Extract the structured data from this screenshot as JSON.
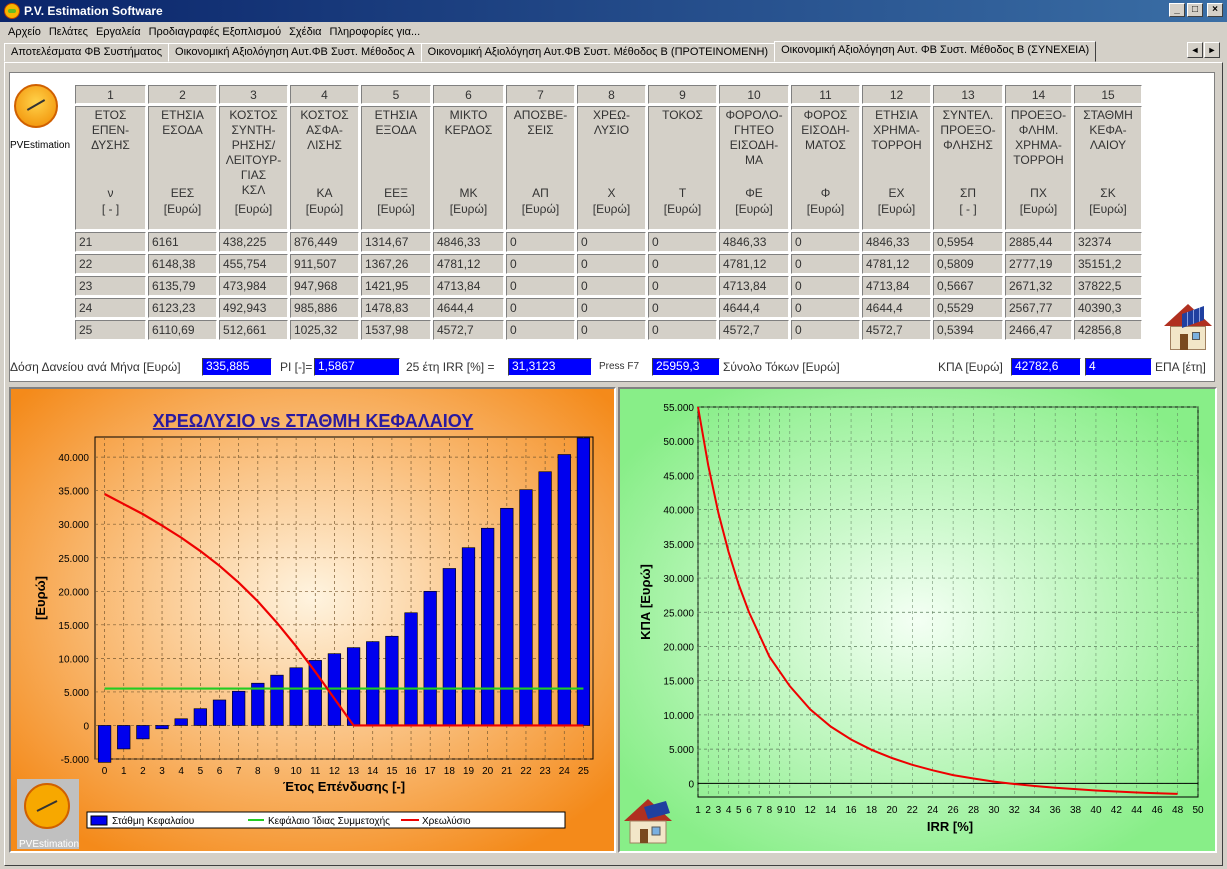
{
  "window": {
    "title": "P.V. Estimation Software"
  },
  "menu": [
    "Αρχείο",
    "Πελάτες",
    "Εργαλεία",
    "Προδιαγραφές Εξοπλισμού",
    "Σχέδια",
    "Πληροφορίες για..."
  ],
  "tabs": [
    "Αποτελέσματα ΦΒ Συστήματος",
    "Οικονομική Αξιολόγηση Αυτ.ΦΒ Συστ. Μέθοδος Α",
    "Οικονομική Αξιολόγηση Αυτ.ΦΒ Συστ. Μέθοδος Β (ΠΡΟΤΕΙΝΟΜΕΝΗ)",
    "Οικονομική Αξιολόγηση Αυτ. ΦΒ Συστ. Μέθοδος Β (ΣΥΝΕΧΕΙΑ)"
  ],
  "logo_caption": "PVEstimation",
  "table": {
    "col_numbers": [
      "1",
      "2",
      "3",
      "4",
      "5",
      "6",
      "7",
      "8",
      "9",
      "10",
      "11",
      "12",
      "13",
      "14",
      "15"
    ],
    "headers": [
      {
        "name": "ΕΤΟΣ\nΕΠΕΝ-\nΔΥΣΗΣ",
        "sym": "ν\n[ - ]"
      },
      {
        "name": "ΕΤΗΣΙΑ\nΕΣΟΔΑ",
        "sym": "ΕΕΣ\n[Ευρώ]"
      },
      {
        "name": "ΚΟΣΤΟΣ\nΣΥΝΤΗ-\nΡΗΣΗΣ/\nΛΕΙΤΟΥΡ-\nΓΙΑΣ\nΚΣΛ",
        "sym": "[Ευρώ]"
      },
      {
        "name": "ΚΟΣΤΟΣ\nΑΣΦΑ-\nΛΙΣΗΣ",
        "sym": "ΚΑ\n[Ευρώ]"
      },
      {
        "name": "ΕΤΗΣΙΑ\nΕΞΟΔΑ",
        "sym": "ΕΕΞ\n[Ευρώ]"
      },
      {
        "name": "ΜΙΚΤΟ\nΚΕΡΔΟΣ",
        "sym": "ΜΚ\n[Ευρώ]"
      },
      {
        "name": "ΑΠΟΣΒΕ-\nΣΕΙΣ",
        "sym": "ΑΠ\n[Ευρώ]"
      },
      {
        "name": "ΧΡΕΩ-\nΛΥΣΙΟ",
        "sym": "Χ\n[Ευρώ]"
      },
      {
        "name": "ΤΟΚΟΣ",
        "sym": "Τ\n[Ευρώ]"
      },
      {
        "name": "ΦΟΡΟΛΟ-\nΓΗΤΕΟ\nΕΙΣΟΔΗ-\nΜΑ",
        "sym": "ΦΕ\n[Ευρώ]"
      },
      {
        "name": "ΦΟΡΟΣ\nΕΙΣΟΔΗ-\nΜΑΤΟΣ",
        "sym": "Φ\n[Ευρώ]"
      },
      {
        "name": "ΕΤΗΣΙΑ\nΧΡΗΜΑ-\nΤΟΡΡΟΗ",
        "sym": "ΕΧ\n[Ευρώ]"
      },
      {
        "name": "ΣΥΝΤΕΛ.\nΠΡΟΕΞΟ-\nΦΛΗΣΗΣ",
        "sym": "ΣΠ\n[ - ]"
      },
      {
        "name": "ΠΡΟΕΞΟ-\nΦΛΗΜ.\nΧΡΗΜΑ-\nΤΟΡΡΟΗ",
        "sym": "ΠΧ\n[Ευρώ]"
      },
      {
        "name": "ΣΤΑΘΜΗ\nΚΕΦΑ-\nΛΑΙΟΥ",
        "sym": "ΣΚ\n[Ευρώ]"
      }
    ],
    "rows": [
      [
        "21",
        "6161",
        "438,225",
        "876,449",
        "1314,67",
        "4846,33",
        "0",
        "0",
        "0",
        "4846,33",
        "0",
        "4846,33",
        "0,5954",
        "2885,44",
        "32374"
      ],
      [
        "22",
        "6148,38",
        "455,754",
        "911,507",
        "1367,26",
        "4781,12",
        "0",
        "0",
        "0",
        "4781,12",
        "0",
        "4781,12",
        "0,5809",
        "2777,19",
        "35151,2"
      ],
      [
        "23",
        "6135,79",
        "473,984",
        "947,968",
        "1421,95",
        "4713,84",
        "0",
        "0",
        "0",
        "4713,84",
        "0",
        "4713,84",
        "0,5667",
        "2671,32",
        "37822,5"
      ],
      [
        "24",
        "6123,23",
        "492,943",
        "985,886",
        "1478,83",
        "4644,4",
        "0",
        "0",
        "0",
        "4644,4",
        "0",
        "4644,4",
        "0,5529",
        "2567,77",
        "40390,3"
      ],
      [
        "25",
        "6110,69",
        "512,661",
        "1025,32",
        "1537,98",
        "4572,7",
        "0",
        "0",
        "0",
        "4572,7",
        "0",
        "4572,7",
        "0,5394",
        "2466,47",
        "42856,8"
      ]
    ]
  },
  "summary": {
    "loan_label": "Δόση Δανείου ανά Μήνα [Ευρώ]",
    "loan_value": "335,885",
    "pi_label": "PI [-]=",
    "pi_value": "1,5867",
    "irr_label": "25 έτη IRR [%] =",
    "irr_value": "31,3123",
    "press_label": "Press F7",
    "interest_value": "25959,3",
    "interest_label": "Σύνολο Τόκων [Ευρώ]",
    "npv_label": "ΚΠΑ [Ευρώ]",
    "npv_value": "42782,6",
    "payback_value": "4",
    "payback_label": "ΕΠΑ [έτη]"
  },
  "colors": {
    "bar": "#0000ee",
    "equity_line": "#22cc22",
    "amortization_line": "#ee0000",
    "left_bg": "#f48a1a",
    "right_bg": "#88ee88"
  },
  "chart_data": [
    {
      "type": "bar",
      "title": "ΧΡΕΩΛΥΣΙΟ vs ΣΤΑΘΜΗ ΚΕΦΑΛΑΙΟΥ",
      "xlabel": "Έτος Επένδυσης [-]",
      "ylabel": "[Ευρώ]",
      "ylim": [
        -5000,
        43000
      ],
      "yticks": [
        "-5.000",
        "0",
        "5.000",
        "10.000",
        "15.000",
        "20.000",
        "25.000",
        "30.000",
        "35.000",
        "40.000"
      ],
      "grid": true,
      "legend_position": "bottom",
      "categories": [
        0,
        1,
        2,
        3,
        4,
        5,
        6,
        7,
        8,
        9,
        10,
        11,
        12,
        13,
        14,
        15,
        16,
        17,
        18,
        19,
        20,
        21,
        22,
        23,
        24,
        25
      ],
      "series": [
        {
          "name": "Στάθμη Κεφαλαίου",
          "type": "bar",
          "values": [
            -5500,
            -3500,
            -2000,
            -500,
            1000,
            2500,
            3800,
            5100,
            6300,
            7500,
            8600,
            9700,
            10700,
            11600,
            12500,
            13300,
            16800,
            20000,
            23400,
            26500,
            29400,
            32374,
            35151,
            37822,
            40390,
            42857
          ]
        },
        {
          "name": "Κεφάλαιο Ίδιας Συμμετοχής",
          "type": "line",
          "values": [
            5500,
            5500,
            5500,
            5500,
            5500,
            5500,
            5500,
            5500,
            5500,
            5500,
            5500,
            5500,
            5500,
            5500,
            5500,
            5500,
            5500,
            5500,
            5500,
            5500,
            5500,
            5500,
            5500,
            5500,
            5500,
            5500
          ]
        },
        {
          "name": "Χρεωλύσιο",
          "type": "line",
          "values": [
            34500,
            33000,
            31500,
            29800,
            28000,
            26000,
            23800,
            21300,
            18500,
            15300,
            11800,
            8000,
            4000,
            0,
            0,
            0,
            0,
            0,
            0,
            0,
            0,
            0,
            0,
            0,
            0,
            0
          ],
          "x": [
            0,
            1,
            2,
            3,
            4,
            5,
            6,
            7,
            8,
            9,
            10,
            11,
            12,
            13,
            14,
            15,
            16,
            17,
            18,
            19,
            20,
            21,
            22,
            23,
            24,
            25
          ]
        }
      ]
    },
    {
      "type": "line",
      "xlabel": "IRR [%]",
      "ylabel": "ΚΠΑ [Ευρώ]",
      "ylim": [
        -2000,
        55000
      ],
      "xlim": [
        1,
        50
      ],
      "yticks": [
        "0",
        "5.000",
        "10.000",
        "15.000",
        "20.000",
        "25.000",
        "30.000",
        "35.000",
        "40.000",
        "45.000",
        "50.000",
        "55.000"
      ],
      "xticks": [
        "1",
        "2",
        "3",
        "4",
        "5",
        "6",
        "7",
        "8",
        "9",
        "10",
        "12",
        "14",
        "16",
        "18",
        "20",
        "22",
        "24",
        "26",
        "28",
        "30",
        "32",
        "34",
        "36",
        "38",
        "40",
        "42",
        "44",
        "46",
        "48",
        "50"
      ],
      "grid": true,
      "series": [
        {
          "x": [
            1,
            2,
            3,
            4,
            5,
            6,
            8,
            10,
            12,
            14,
            16,
            18,
            20,
            22,
            24,
            26,
            28,
            30,
            32,
            34,
            36,
            38,
            40,
            42,
            44,
            46,
            48
          ],
          "values": [
            55000,
            46500,
            39500,
            33800,
            29000,
            25000,
            18500,
            14200,
            10800,
            8300,
            6400,
            4900,
            3700,
            2700,
            1900,
            1200,
            700,
            250,
            -100,
            -400,
            -650,
            -850,
            -1050,
            -1200,
            -1350,
            -1450,
            -1550
          ]
        }
      ]
    }
  ]
}
